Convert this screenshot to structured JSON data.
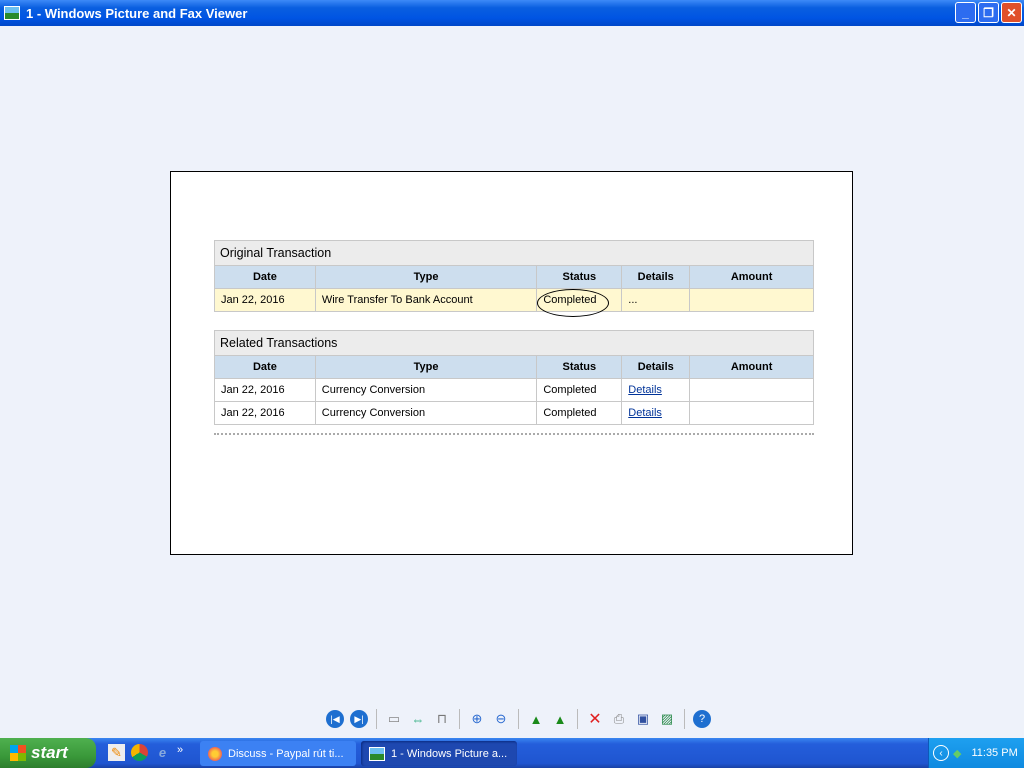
{
  "window": {
    "title": "1 - Windows Picture and Fax Viewer"
  },
  "original": {
    "caption": "Original Transaction",
    "headers": [
      "Date",
      "Type",
      "Status",
      "Details",
      "Amount"
    ],
    "row": {
      "date": "Jan 22, 2016",
      "type": "Wire Transfer To Bank Account",
      "status": "Completed",
      "details": "..."
    }
  },
  "related": {
    "caption": "Related Transactions",
    "headers": [
      "Date",
      "Type",
      "Status",
      "Details",
      "Amount"
    ],
    "rows": [
      {
        "date": "Jan 22, 2016",
        "type": "Currency Conversion",
        "status": "Completed",
        "details": "Details"
      },
      {
        "date": "Jan 22, 2016",
        "type": "Currency Conversion",
        "status": "Completed",
        "details": "Details"
      }
    ]
  },
  "taskbar": {
    "start": "start",
    "tasks": [
      "Discuss - Paypal rút ti...",
      "1 - Windows Picture a..."
    ],
    "clock": "11:35 PM",
    "chevron": "»"
  }
}
